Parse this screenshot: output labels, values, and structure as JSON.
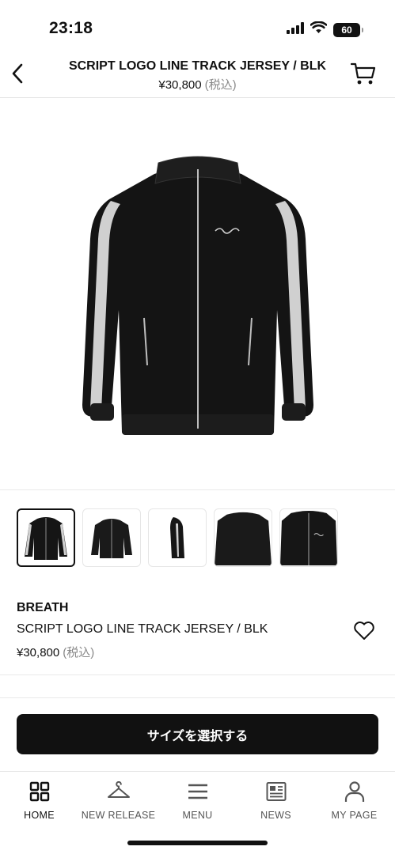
{
  "status": {
    "time": "23:18",
    "battery": "60"
  },
  "header": {
    "title": "SCRIPT LOGO LINE TRACK JERSEY / BLK",
    "price": "¥30,800",
    "tax": "(税込)"
  },
  "gallery": {
    "thumbnails": [
      "front-view",
      "front-view-alt",
      "side-view",
      "back-view",
      "detail-view"
    ],
    "selected_index": 0
  },
  "product": {
    "brand": "BREATH",
    "name": "SCRIPT LOGO LINE TRACK JERSEY / BLK",
    "price": "¥30,800",
    "tax": "(税込)"
  },
  "cta": {
    "label": "サイズを選択する"
  },
  "tabbar": {
    "items": [
      {
        "label": "HOME",
        "icon": "grid-icon",
        "active": true
      },
      {
        "label": "NEW RELEASE",
        "icon": "hanger-icon",
        "active": false
      },
      {
        "label": "MENU",
        "icon": "menu-icon",
        "active": false
      },
      {
        "label": "NEWS",
        "icon": "newspaper-icon",
        "active": false
      },
      {
        "label": "MY PAGE",
        "icon": "person-icon",
        "active": false
      }
    ]
  }
}
